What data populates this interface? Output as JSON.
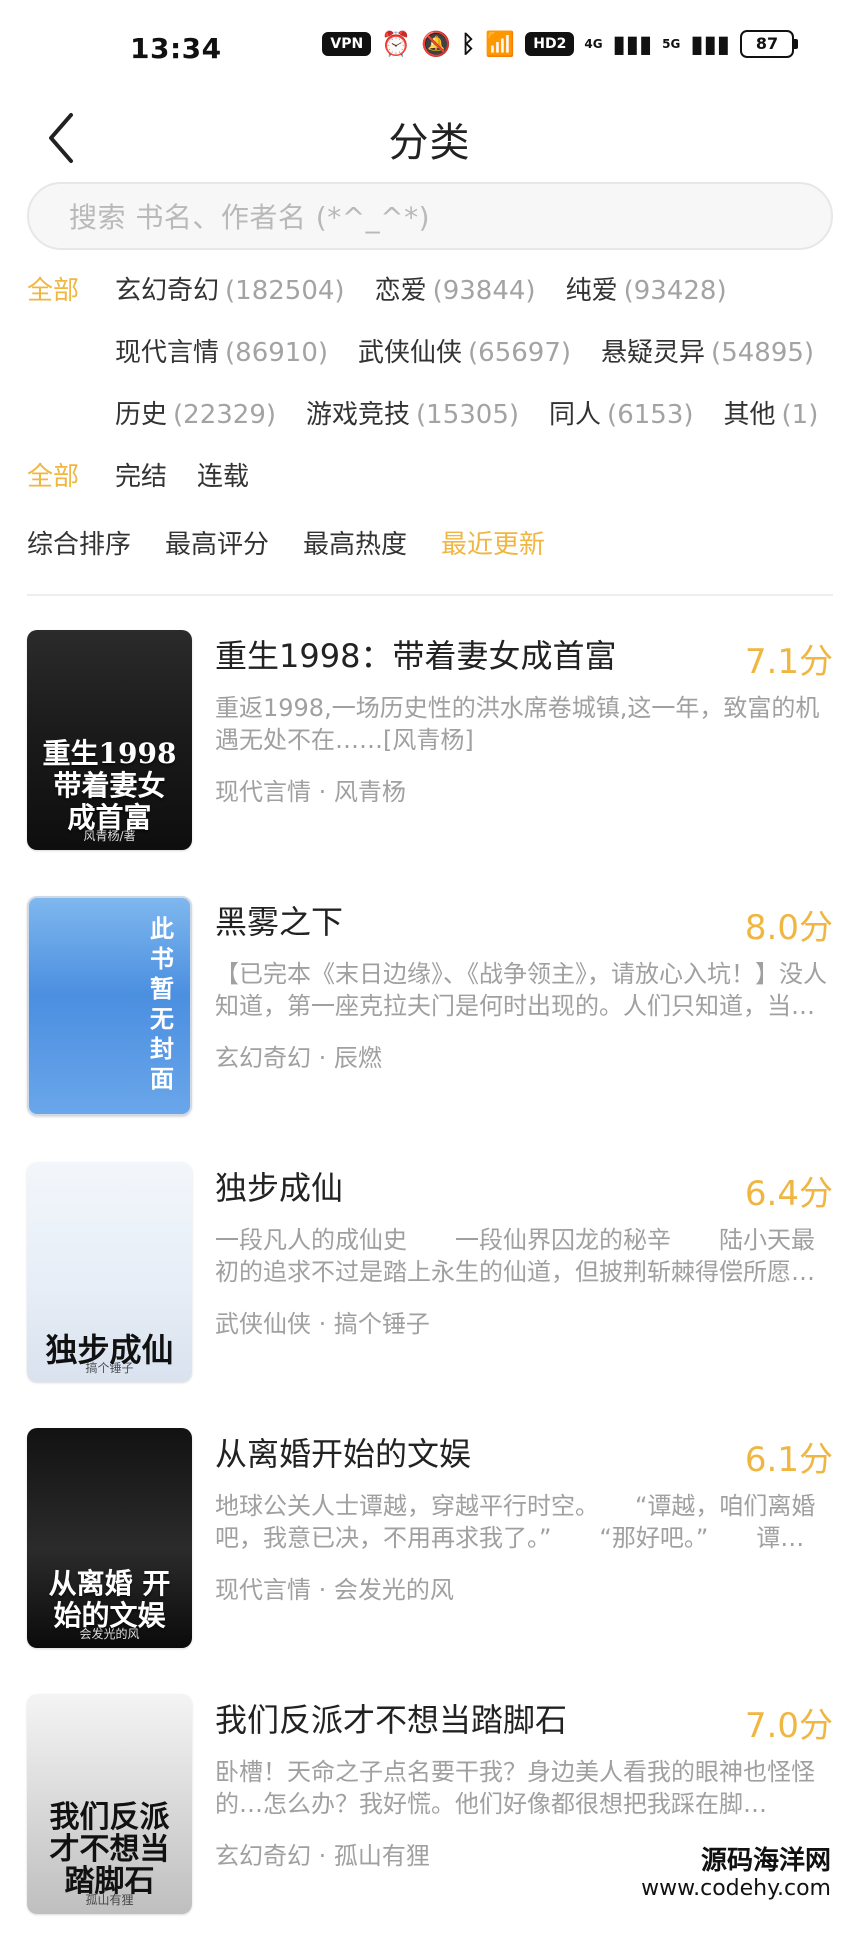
{
  "status_bar": {
    "time": "13:34",
    "vpn": "VPN",
    "hd": "HD2",
    "network_1": "4G",
    "network_2": "5G",
    "battery": "87"
  },
  "header": {
    "title": "分类"
  },
  "search": {
    "placeholder": "搜索 书名、作者名 (*^_^*)"
  },
  "filters": {
    "genre": {
      "label": "全部",
      "items": [
        {
          "name": "玄幻奇幻",
          "count": "(182504)"
        },
        {
          "name": "恋爱",
          "count": "(93844)"
        },
        {
          "name": "纯爱",
          "count": "(93428)"
        },
        {
          "name": "现代言情",
          "count": "(86910)"
        },
        {
          "name": "武侠仙侠",
          "count": "(65697)"
        },
        {
          "name": "悬疑灵异",
          "count": "(54895)"
        },
        {
          "name": "历史",
          "count": "(22329)"
        },
        {
          "name": "游戏竞技",
          "count": "(15305)"
        },
        {
          "name": "同人",
          "count": "(6153)"
        },
        {
          "name": "其他",
          "count": "(1)"
        }
      ]
    },
    "status": {
      "label": "全部",
      "items": [
        "完结",
        "连载"
      ]
    },
    "sort": {
      "items": [
        "综合排序",
        "最高评分",
        "最高热度",
        "最近更新"
      ],
      "active": "最近更新"
    }
  },
  "books": [
    {
      "title": "重生1998：带着妻女成首富",
      "score": "7.1分",
      "desc": "重返1998,一场历史性的洪水席卷城镇,这一年，致富的机遇无处不在……[风青杨]",
      "category": "现代言情",
      "author": "风青杨",
      "cover_title": "重生1998\n带着妻女\n成首富",
      "cover_sub": "风青杨/著"
    },
    {
      "title": "黑雾之下",
      "score": "8.0分",
      "desc": "【已完本《末日边缘》、《战争领主》，请放心入坑！】没人知道，第一座克拉夫门是何时出现的。人们只知道，当…",
      "category": "玄幻奇幻",
      "author": "辰燃",
      "cover_vertical": "此书暂无封面"
    },
    {
      "title": "独步成仙",
      "score": "6.4分",
      "desc": "一段凡人的成仙史　　一段仙界囚龙的秘辛　　陆小天最初的追求不过是踏上永生的仙道，但披荆斩棘得偿所愿之…",
      "category": "武侠仙侠",
      "author": "搞个锤子",
      "cover_title": "独步成仙",
      "cover_sub": "搞个锤子"
    },
    {
      "title": "从离婚开始的文娱",
      "score": "6.1分",
      "desc": "地球公关人士谭越，穿越平行时空。　　“谭越，咱们离婚吧，我意已决，不用再求我了。”　　“那好吧。”　　谭…",
      "category": "现代言情",
      "author": "会发光的风",
      "cover_title": "从离婚\n开始的文娱",
      "cover_sub": "会发光的风"
    },
    {
      "title": "我们反派才不想当踏脚石",
      "score": "7.0分",
      "desc": "卧槽！天命之子点名要干我？身边美人看我的眼神也怪怪的…怎么办？我好慌。他们好像都很想把我踩在脚…",
      "category": "玄幻奇幻",
      "author": "孤山有狸",
      "cover_title": "我们反派\n才不想当\n踏脚石",
      "cover_sub": "孤山有狸"
    }
  ],
  "watermark": {
    "line1": "源码海洋网",
    "line2": "www.codehy.com"
  }
}
